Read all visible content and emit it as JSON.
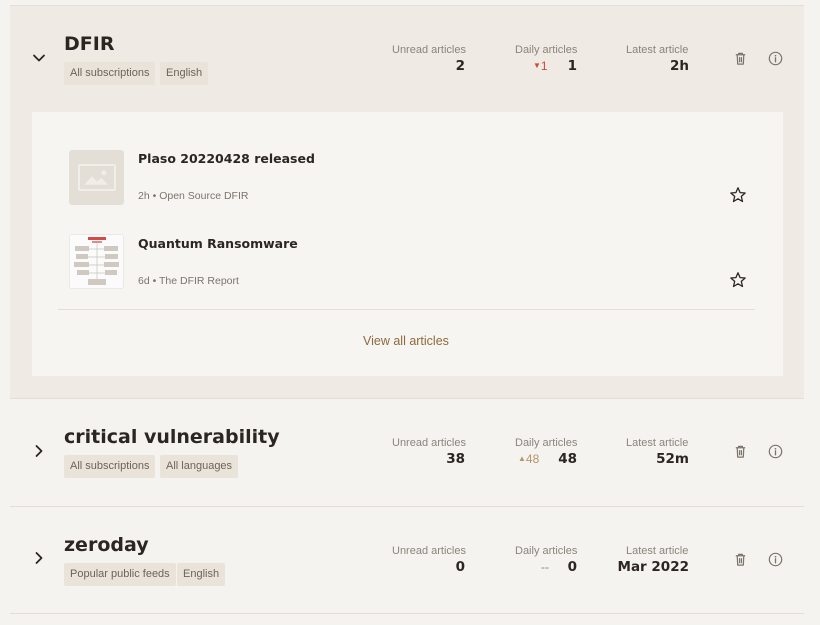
{
  "labels": {
    "unread": "Unread articles",
    "daily": "Daily articles",
    "latest": "Latest article"
  },
  "colors": {
    "delta_down": "#d04a3a",
    "delta_up": "#b6946a",
    "accent_link": "#8c6a3f"
  },
  "icons": {
    "expand": "chevron-down-icon",
    "collapsed": "chevron-right-icon",
    "delete": "trash-icon",
    "info": "info-icon",
    "favorite": "star-icon",
    "placeholder": "image-placeholder-icon"
  },
  "topics": [
    {
      "title": "DFIR",
      "expanded": true,
      "tags": [
        "All subscriptions",
        "English"
      ],
      "unread": "2",
      "daily_delta": "1",
      "daily_delta_direction": "down",
      "daily": "1",
      "latest": "2h",
      "articles": [
        {
          "title": "Plaso 20220428 released",
          "meta": "2h • Open Source DFIR",
          "thumbnail": "placeholder",
          "starred": false
        },
        {
          "title": "Quantum Ransomware",
          "meta": "6d • The DFIR Report",
          "thumbnail": "image",
          "starred": false
        }
      ],
      "view_all": "View all articles"
    },
    {
      "title": "critical vulnerability",
      "expanded": false,
      "tags": [
        "All subscriptions",
        "All languages"
      ],
      "unread": "38",
      "daily_delta": "48",
      "daily_delta_direction": "up",
      "daily": "48",
      "latest": "52m"
    },
    {
      "title": "zeroday",
      "expanded": false,
      "tags": [
        "Popular public feeds",
        "English"
      ],
      "unread": "0",
      "daily_delta": "--",
      "daily_delta_direction": "none",
      "daily": "0",
      "latest": "Mar 2022"
    }
  ]
}
